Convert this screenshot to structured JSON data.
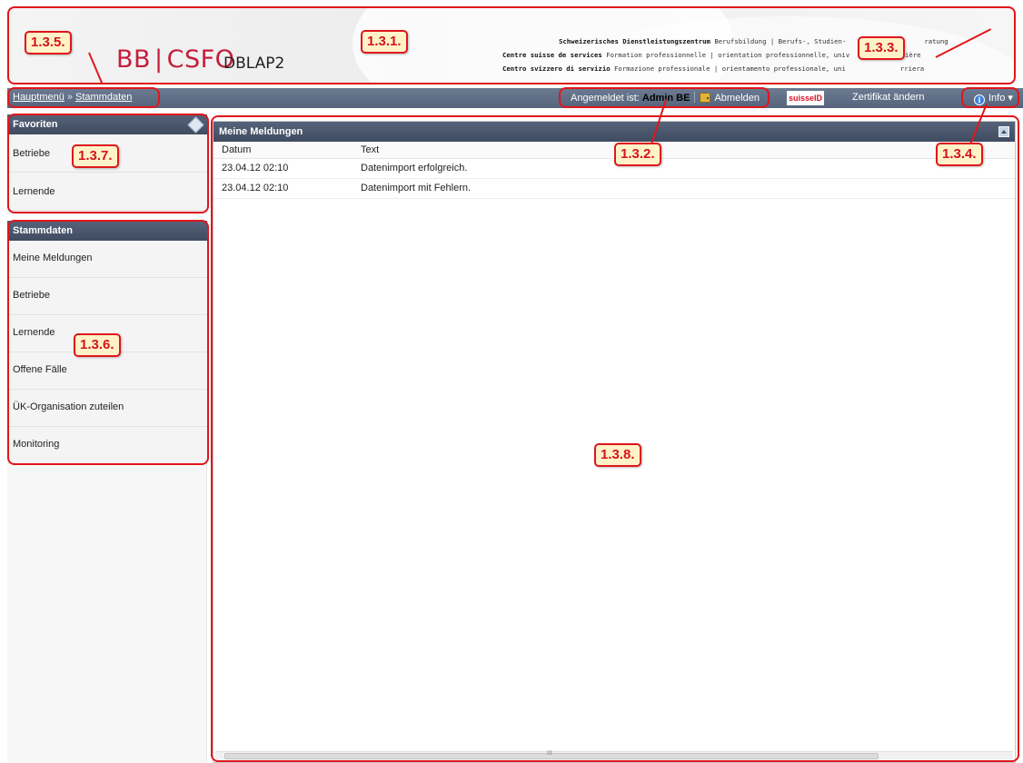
{
  "header": {
    "logo_left": "BB",
    "logo_sep": "|",
    "logo_right": "CSFO",
    "app_name": "DBLAP2",
    "sdbb_line1_bold": "Schweizerisches Dienstleistungszentrum",
    "sdbb_line1": "Berufsbildung | Berufs-, Studien-",
    "sdbb_line1_end": "ratung",
    "sdbb_line2_bold": "Centre suisse de services",
    "sdbb_line2": "Formation professionnelle | orientation professionnelle, univ",
    "sdbb_line2_end": "rrière",
    "sdbb_line3_bold": "Centro svizzero di servizio",
    "sdbb_line3": "Formazione professionale | orientamento professionale, uni",
    "sdbb_line3_end": "rriera"
  },
  "navbar": {
    "crumb1": "Hauptmenü",
    "crumb_sep": "»",
    "crumb2": "Stammdaten",
    "logged_in_label": "Angemeldet ist:",
    "user": "Admin BE",
    "logout": "Abmelden",
    "suisseid": "suisseID",
    "certificate": "Zertifikat ändern",
    "info": "Info",
    "info_caret": "▾"
  },
  "favorites": {
    "title": "Favoriten",
    "items": [
      "Betriebe",
      "Lernende"
    ]
  },
  "stammdaten": {
    "title": "Stammdaten",
    "items": [
      "Meine Meldungen",
      "Betriebe",
      "Lernende",
      "Offene Fälle",
      "ÜK-Organisation zuteilen",
      "Monitoring"
    ]
  },
  "main": {
    "title": "Meine Meldungen",
    "columns": [
      "Datum",
      "Text"
    ],
    "rows": [
      [
        "23.04.12 02:10",
        "Datenimport erfolgreich."
      ],
      [
        "23.04.12 02:10",
        "Datenimport mit Fehlern."
      ]
    ],
    "scroll_mark": "III"
  },
  "annotations": [
    "1.3.1.",
    "1.3.2.",
    "1.3.3.",
    "1.3.4.",
    "1.3.5.",
    "1.3.6.",
    "1.3.7.",
    "1.3.8."
  ],
  "colors": {
    "accent_red": "#c41e3a",
    "annotation_red": "#e0161b",
    "annotation_fill": "#fff2c8",
    "navbar": "#5f6e86",
    "panel_header": "#485569"
  }
}
